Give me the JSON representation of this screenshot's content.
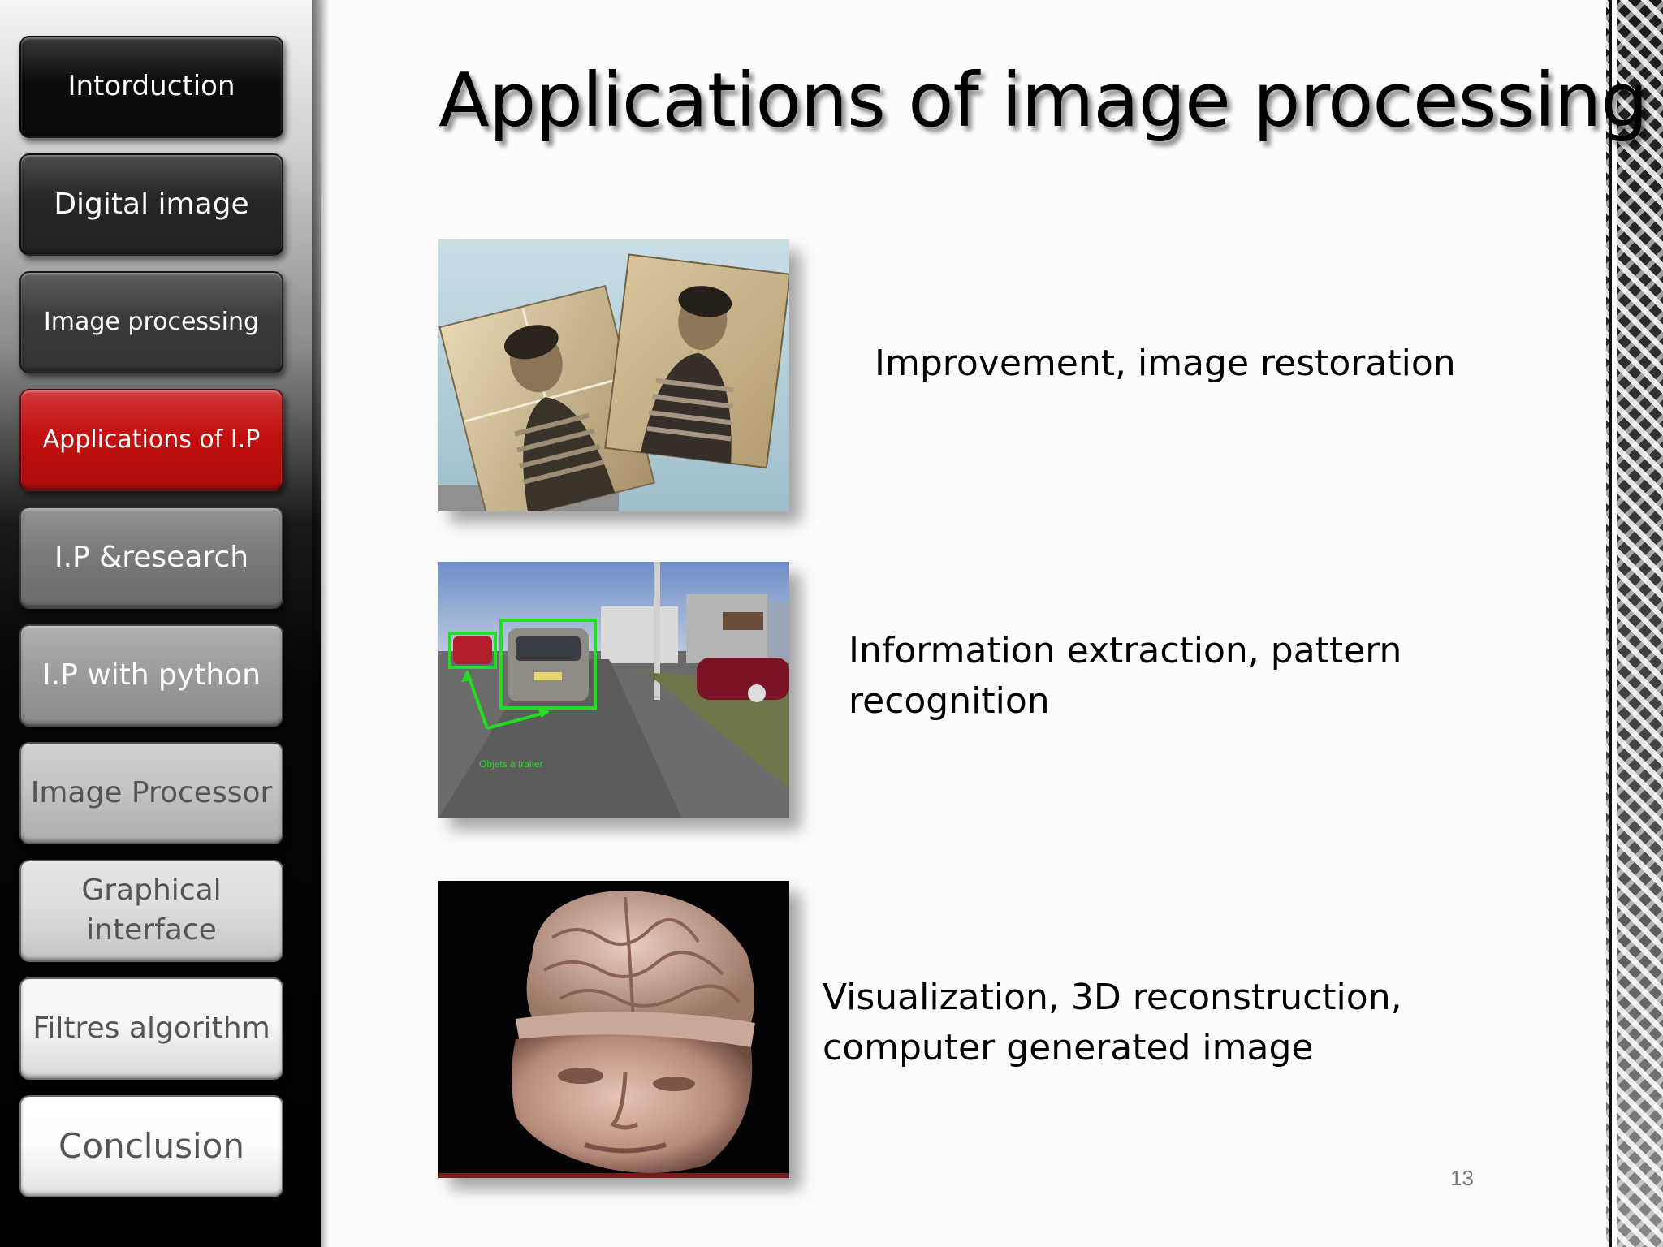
{
  "slide": {
    "title": "Applications of image processing",
    "page_number": "13"
  },
  "nav": {
    "items": [
      {
        "label": "Intorduction",
        "bg": "#0d0d0d",
        "color": "#ffffff",
        "active": false
      },
      {
        "label": "Digital image",
        "bg": "#262626",
        "color": "#ffffff",
        "active": false
      },
      {
        "label": "Image processing",
        "bg": "#3b3b3b",
        "color": "#ffffff",
        "active": false
      },
      {
        "label": "Applications of I.P",
        "bg": "#c40f0f",
        "color": "#ffffff",
        "active": true
      },
      {
        "label": "I.P &research",
        "bg": "#7a7a7a",
        "color": "#ffffff",
        "active": false
      },
      {
        "label": "I.P with python",
        "bg": "#9d9d9d",
        "color": "#ffffff",
        "active": false
      },
      {
        "label": "Image Processor",
        "bg": "#c4c4c4",
        "color": "#555555",
        "active": false
      },
      {
        "label": "Graphical interface",
        "bg": "#dedede",
        "color": "#555555",
        "active": false
      },
      {
        "label": "Filtres algorithm",
        "bg": "#f6f6f6",
        "color": "#555555",
        "active": false
      },
      {
        "label": "Conclusion",
        "bg": "#ffffff",
        "color": "#555555",
        "active": false
      }
    ]
  },
  "applications": [
    {
      "caption": "Improvement, image restoration",
      "image": "restored-photos-image"
    },
    {
      "caption": "Information extraction, pattern recognition",
      "image": "car-detection-image",
      "overlay_text": "Objets à traiter"
    },
    {
      "caption": "Visualization, 3D reconstruction, computer generated image",
      "image": "3d-head-brain-image"
    }
  ],
  "colors": {
    "active_nav": "#c40f0f",
    "detection_box": "#22dd22",
    "background": "#fdfcfd"
  }
}
